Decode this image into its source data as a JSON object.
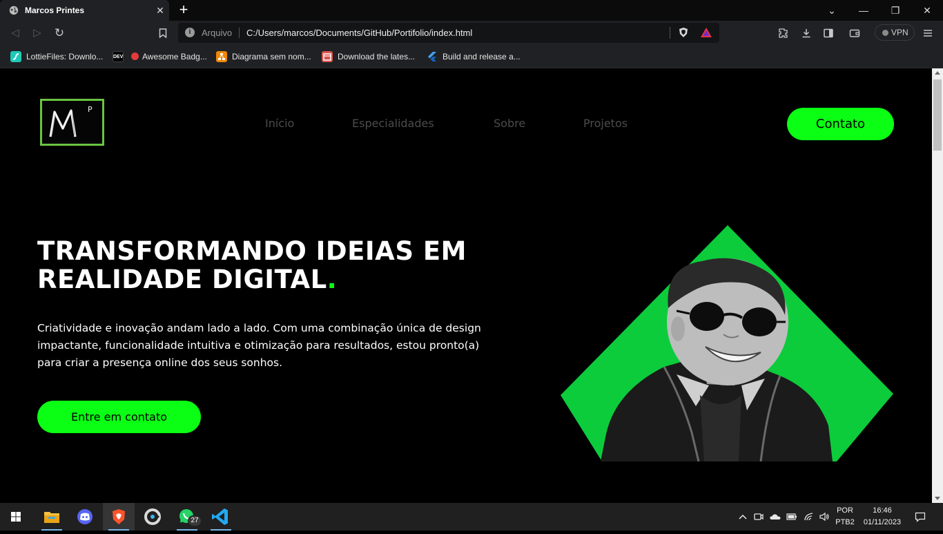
{
  "tab": {
    "title": "Marcos Printes",
    "close_glyph": "✕",
    "new_tab_glyph": "+"
  },
  "window_controls": {
    "dropdown": "⌄",
    "minimize": "—",
    "restore": "❐",
    "close": "✕"
  },
  "toolbar": {
    "back_glyph": "◁",
    "forward_glyph": "▷",
    "reload_glyph": "↻",
    "bookmark_glyph": "⊓",
    "scheme_label": "Arquivo",
    "url": "C:/Users/marcos/Documents/GitHub/Portifolio/index.html",
    "vpn_label": "VPN"
  },
  "bookmarks": [
    {
      "label": "LottieFiles: Downlo...",
      "icon": "lottiefiles-icon",
      "icon_text": "",
      "color": "#1ec9b7"
    },
    {
      "label": "Awesome Badg...",
      "icon": "dev-icon",
      "icon_text": "DEV",
      "color": "#000000"
    },
    {
      "label": "Diagrama sem nom...",
      "icon": "drawio-icon",
      "icon_text": "",
      "color": "#f08705"
    },
    {
      "label": "Download the lates...",
      "icon": "download-icon",
      "icon_text": "",
      "color": "#d9534f"
    },
    {
      "label": "Build and release a...",
      "icon": "flutter-icon",
      "icon_text": "",
      "color": "#42a5f5"
    }
  ],
  "page": {
    "logo_letter": "M",
    "logo_superscript": "P",
    "nav": [
      "Início",
      "Especialidades",
      "Sobre",
      "Projetos"
    ],
    "contact_button": "Contato",
    "hero_title_line1": "TRANSFORMANDO IDEIAS EM",
    "hero_title_line2": "REALIDADE DIGITAL",
    "hero_title_dot": ".",
    "hero_description": "Criatividade e inovação andam lado a lado. Com uma combinação única de design impactante, funcionalidade intuitiva e otimização para resultados, estou pronto(a) para criar a presença online dos seus sonhos.",
    "cta_button": "Entre em contato"
  },
  "taskbar": {
    "apps": [
      "file-explorer-icon",
      "discord-icon",
      "brave-icon",
      "ccleaner-icon",
      "whatsapp-icon",
      "vscode-icon"
    ],
    "whatsapp_badge": "27",
    "language": "POR",
    "keyboard": "PTB2",
    "time": "16:46",
    "date": "01/11/2023"
  },
  "colors": {
    "accent": "#0aff14",
    "diamond": "#0ccc3c",
    "logo_border": "#6ac440"
  }
}
